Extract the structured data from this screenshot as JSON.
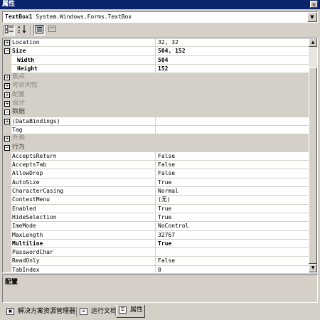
{
  "window": {
    "title": "属性",
    "close_glyph": "×"
  },
  "selector": {
    "name": "TextBox1",
    "type": "System.Windows.Forms.TextBox"
  },
  "toolbar": {
    "categorized_icon": "categorized-icon",
    "alphabetical_icon": "alphabetical-icon",
    "properties_icon": "properties-icon",
    "events_icon": "events-icon"
  },
  "grid": {
    "rows": [
      {
        "name": "Location",
        "value": "32, 32",
        "kind": "prop",
        "expander": "+",
        "bold": false
      },
      {
        "name": "Size",
        "value": "504, 152",
        "kind": "prop",
        "expander": "−",
        "bold": true
      },
      {
        "name": "Width",
        "value": "504",
        "kind": "sub",
        "bold": true
      },
      {
        "name": "Height",
        "value": "152",
        "kind": "sub",
        "bold": true
      },
      {
        "name": "焦点",
        "kind": "cat",
        "expander": "+"
      },
      {
        "name": "可访问性",
        "kind": "cat",
        "expander": "+"
      },
      {
        "name": "配置",
        "kind": "cat",
        "expander": "+"
      },
      {
        "name": "设计",
        "kind": "cat",
        "expander": "+"
      },
      {
        "name": "数据",
        "kind": "cat",
        "expander": "−",
        "open": true
      },
      {
        "name": "(DataBindings)",
        "value": "",
        "kind": "prop",
        "expander": "+"
      },
      {
        "name": "Tag",
        "value": "",
        "kind": "prop"
      },
      {
        "name": "外观",
        "kind": "cat",
        "expander": "+"
      },
      {
        "name": "行为",
        "kind": "cat",
        "expander": "−",
        "open": true
      },
      {
        "name": "AcceptsReturn",
        "value": "False",
        "kind": "prop"
      },
      {
        "name": "AcceptsTab",
        "value": "False",
        "kind": "prop"
      },
      {
        "name": "AllowDrop",
        "value": "False",
        "kind": "prop"
      },
      {
        "name": "AutoSize",
        "value": "True",
        "kind": "prop"
      },
      {
        "name": "CharacterCasing",
        "value": "Normal",
        "kind": "prop"
      },
      {
        "name": "ContextMenu",
        "value": "(无)",
        "kind": "prop"
      },
      {
        "name": "Enabled",
        "value": "True",
        "kind": "prop"
      },
      {
        "name": "HideSelection",
        "value": "True",
        "kind": "prop"
      },
      {
        "name": "ImeMode",
        "value": "NoControl",
        "kind": "prop"
      },
      {
        "name": "MaxLength",
        "value": "32767",
        "kind": "prop"
      },
      {
        "name": "Multiline",
        "value": "True",
        "kind": "prop",
        "bold": true
      },
      {
        "name": "PasswordChar",
        "value": "",
        "kind": "prop"
      },
      {
        "name": "ReadOnly",
        "value": "False",
        "kind": "prop"
      },
      {
        "name": "TabIndex",
        "value": "0",
        "kind": "prop"
      }
    ]
  },
  "description": {
    "title": "配置"
  },
  "tabs": [
    {
      "label": "解决方案资源管理器",
      "icon": "solution-explorer-icon",
      "active": false
    },
    {
      "label": "运行文档",
      "icon": "running-documents-icon",
      "active": false
    },
    {
      "label": "属性",
      "icon": "properties-window-icon",
      "active": true
    }
  ]
}
